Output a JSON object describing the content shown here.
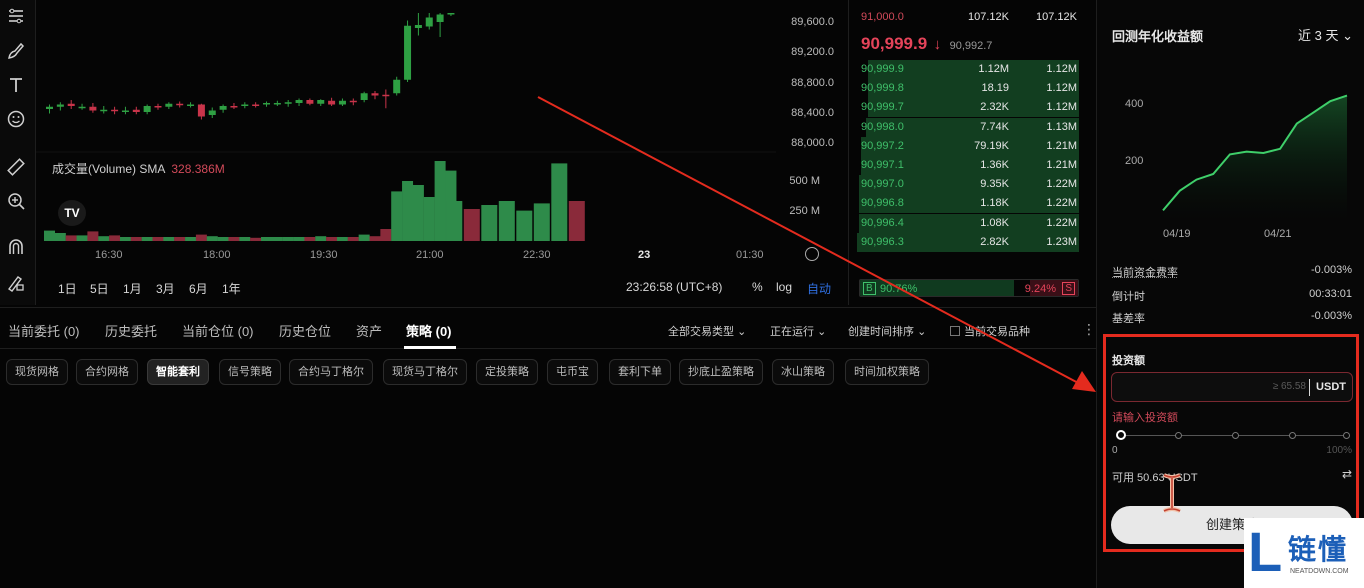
{
  "toolbar": {
    "icons": [
      "lines-icon",
      "brush-icon",
      "text-icon",
      "emoji-icon",
      "ruler-icon",
      "zoom-in-icon",
      "magnet-icon",
      "lock-pen-icon"
    ]
  },
  "chart": {
    "price_ticks": [
      "89,600.0",
      "89,200.0",
      "88,800.0",
      "88,400.0",
      "88,000.0"
    ],
    "volume_ticks": [
      "500 M",
      "250 M"
    ],
    "time_ticks": [
      "16:30",
      "18:00",
      "19:30",
      "21:00",
      "22:30",
      "23",
      "01:30"
    ],
    "volume_legend_label": "成交量(Volume) SMA",
    "volume_legend_value": "328.386M",
    "logo": "TV",
    "ranges": [
      "1日",
      "5日",
      "1月",
      "3月",
      "6月",
      "1年"
    ],
    "clock": "23:26:58 (UTC+8)",
    "percent": "%",
    "log": "log",
    "auto": "自动",
    "colors": {
      "up": "#2ea043",
      "down": "#c9344a",
      "volume_up": "#2e8b4a",
      "volume_down": "#8a2a3a"
    }
  },
  "chart_data": {
    "type": "candlestick",
    "y_axis": {
      "ticks": [
        89600,
        89200,
        88800,
        88400,
        88000
      ]
    },
    "volume_axis": {
      "ticks": [
        "500 M",
        "250 M"
      ]
    },
    "x_ticks": [
      "16:30",
      "18:00",
      "19:30",
      "21:00",
      "22:30",
      "23",
      "01:30"
    ],
    "candles": [
      {
        "o": 88440,
        "c": 88470,
        "h": 88500,
        "l": 88380,
        "v": 0.13
      },
      {
        "o": 88470,
        "c": 88500,
        "h": 88530,
        "l": 88420,
        "v": 0.1
      },
      {
        "o": 88510,
        "c": 88480,
        "h": 88560,
        "l": 88440,
        "v": 0.07
      },
      {
        "o": 88470,
        "c": 88470,
        "h": 88510,
        "l": 88430,
        "v": 0.07
      },
      {
        "o": 88470,
        "c": 88420,
        "h": 88520,
        "l": 88390,
        "v": 0.12
      },
      {
        "o": 88420,
        "c": 88430,
        "h": 88480,
        "l": 88380,
        "v": 0.06
      },
      {
        "o": 88430,
        "c": 88410,
        "h": 88470,
        "l": 88370,
        "v": 0.07
      },
      {
        "o": 88410,
        "c": 88420,
        "h": 88470,
        "l": 88370,
        "v": 0.05
      },
      {
        "o": 88430,
        "c": 88400,
        "h": 88470,
        "l": 88370,
        "v": 0.05
      },
      {
        "o": 88400,
        "c": 88480,
        "h": 88500,
        "l": 88370,
        "v": 0.05
      },
      {
        "o": 88480,
        "c": 88470,
        "h": 88510,
        "l": 88430,
        "v": 0.05
      },
      {
        "o": 88470,
        "c": 88510,
        "h": 88530,
        "l": 88440,
        "v": 0.05
      },
      {
        "o": 88510,
        "c": 88500,
        "h": 88540,
        "l": 88460,
        "v": 0.05
      },
      {
        "o": 88500,
        "c": 88500,
        "h": 88530,
        "l": 88460,
        "v": 0.05
      },
      {
        "o": 88500,
        "c": 88340,
        "h": 88510,
        "l": 88300,
        "v": 0.08
      },
      {
        "o": 88360,
        "c": 88420,
        "h": 88460,
        "l": 88320,
        "v": 0.06
      },
      {
        "o": 88430,
        "c": 88480,
        "h": 88500,
        "l": 88390,
        "v": 0.05
      },
      {
        "o": 88480,
        "c": 88470,
        "h": 88520,
        "l": 88440,
        "v": 0.05
      },
      {
        "o": 88480,
        "c": 88500,
        "h": 88530,
        "l": 88450,
        "v": 0.05
      },
      {
        "o": 88500,
        "c": 88490,
        "h": 88530,
        "l": 88460,
        "v": 0.04
      },
      {
        "o": 88500,
        "c": 88520,
        "h": 88540,
        "l": 88470,
        "v": 0.05
      },
      {
        "o": 88520,
        "c": 88520,
        "h": 88550,
        "l": 88480,
        "v": 0.05
      },
      {
        "o": 88510,
        "c": 88530,
        "h": 88560,
        "l": 88470,
        "v": 0.05
      },
      {
        "o": 88520,
        "c": 88560,
        "h": 88580,
        "l": 88480,
        "v": 0.05
      },
      {
        "o": 88560,
        "c": 88510,
        "h": 88580,
        "l": 88490,
        "v": 0.05
      },
      {
        "o": 88510,
        "c": 88560,
        "h": 88570,
        "l": 88480,
        "v": 0.06
      },
      {
        "o": 88550,
        "c": 88500,
        "h": 88590,
        "l": 88480,
        "v": 0.05
      },
      {
        "o": 88500,
        "c": 88550,
        "h": 88580,
        "l": 88480,
        "v": 0.05
      },
      {
        "o": 88550,
        "c": 88540,
        "h": 88580,
        "l": 88490,
        "v": 0.05
      },
      {
        "o": 88560,
        "c": 88650,
        "h": 88670,
        "l": 88530,
        "v": 0.08
      },
      {
        "o": 88650,
        "c": 88620,
        "h": 88680,
        "l": 88570,
        "v": 0.06
      },
      {
        "o": 88630,
        "c": 88620,
        "h": 88700,
        "l": 88450,
        "v": 0.15
      },
      {
        "o": 88650,
        "c": 88830,
        "h": 88870,
        "l": 88620,
        "v": 0.62
      },
      {
        "o": 88830,
        "c": 89550,
        "h": 89620,
        "l": 88800,
        "v": 0.75
      },
      {
        "o": 89520,
        "c": 89560,
        "h": 89720,
        "l": 89420,
        "v": 0.7
      },
      {
        "o": 89540,
        "c": 89660,
        "h": 89720,
        "l": 89500,
        "v": 0.55
      },
      {
        "o": 89600,
        "c": 89700,
        "h": 89720,
        "l": 89400,
        "v": 1.0
      },
      {
        "o": 89700,
        "c": 89720,
        "h": 89720,
        "l": 89680,
        "v": 0.88
      }
    ],
    "volume_only": [
      {
        "v": 0.5,
        "up": true
      },
      {
        "v": 0.4,
        "up": false
      },
      {
        "v": 0.45,
        "up": true
      },
      {
        "v": 0.5,
        "up": true
      },
      {
        "v": 0.38,
        "up": true
      },
      {
        "v": 0.47,
        "up": true
      },
      {
        "v": 0.97,
        "up": true
      },
      {
        "v": 0.5,
        "up": false
      }
    ]
  },
  "orderbook": {
    "asks": [
      {
        "price": "91,000.0",
        "amount": "107.12K",
        "total": "107.12K"
      }
    ],
    "last_price": "90,999.9",
    "last_arrow": "↓",
    "mark_price": "90,992.7",
    "bids": [
      {
        "price": "90,999.9",
        "amount": "1.12M",
        "total": "1.12M",
        "depth": 0.95
      },
      {
        "price": "90,999.8",
        "amount": "18.19",
        "total": "1.12M",
        "depth": 0.95
      },
      {
        "price": "90,999.7",
        "amount": "2.32K",
        "total": "1.12M",
        "depth": 0.95
      },
      {
        "price": "90,998.0",
        "amount": "7.74K",
        "total": "1.13M",
        "depth": 0.96
      },
      {
        "price": "90,997.2",
        "amount": "79.19K",
        "total": "1.21M",
        "depth": 0.98
      },
      {
        "price": "90,997.1",
        "amount": "1.36K",
        "total": "1.21M",
        "depth": 0.98
      },
      {
        "price": "90,997.0",
        "amount": "9.35K",
        "total": "1.22M",
        "depth": 0.99
      },
      {
        "price": "90,996.8",
        "amount": "1.18K",
        "total": "1.22M",
        "depth": 0.99
      },
      {
        "price": "90,996.4",
        "amount": "1.08K",
        "total": "1.22M",
        "depth": 0.99
      },
      {
        "price": "90,996.3",
        "amount": "2.82K",
        "total": "1.23M",
        "depth": 1.0
      }
    ],
    "ratio_buy_label": "B",
    "ratio_buy": "90.76%",
    "ratio_sell": "9.24%",
    "ratio_sell_label": "S",
    "ratio_buy_fraction": 0.9076
  },
  "tabs": {
    "items": [
      "当前委托 (0)",
      "历史委托",
      "当前仓位 (0)",
      "历史仓位",
      "资产",
      "策略 (0)"
    ],
    "active_index": 5,
    "filters": [
      "全部交易类型",
      "正在运行",
      "创建时间排序",
      "当前交易品种"
    ]
  },
  "chips": {
    "items": [
      "现货网格",
      "合约网格",
      "智能套利",
      "信号策略",
      "合约马丁格尔",
      "现货马丁格尔",
      "定投策略",
      "屯币宝",
      "套利下单",
      "抄底止盈策略",
      "冰山策略",
      "时间加权策略"
    ],
    "active_index": 2
  },
  "right": {
    "title": "回测年化收益额",
    "period": "近 3 天",
    "y_ticks": [
      "400",
      "200"
    ],
    "x_ticks": [
      "04/19",
      "04/21"
    ],
    "rows": [
      {
        "label": "当前资金费率",
        "value": "-0.003%"
      },
      {
        "label": "倒计时",
        "value": "00:33:01"
      },
      {
        "label": "基差率",
        "value": "-0.003%"
      }
    ],
    "invest_label": "投资额",
    "input_placeholder": "≥ 65.58",
    "input_unit": "USDT",
    "error": "请输入投资额",
    "slider_min": "0",
    "slider_max": "100%",
    "slider_value": 0,
    "available": "可用 50.63 USDT",
    "create_button": "创建策略"
  },
  "mini_chart": {
    "type": "area",
    "x_ticks": [
      "04/19",
      "04/21"
    ],
    "y_ticks": [
      400,
      200
    ],
    "values": [
      20,
      90,
      130,
      150,
      220,
      230,
      225,
      240,
      330,
      370,
      410,
      430
    ]
  },
  "watermark": {
    "logo": "L",
    "name": "链懂",
    "url": "NEATDOWN.COM"
  }
}
